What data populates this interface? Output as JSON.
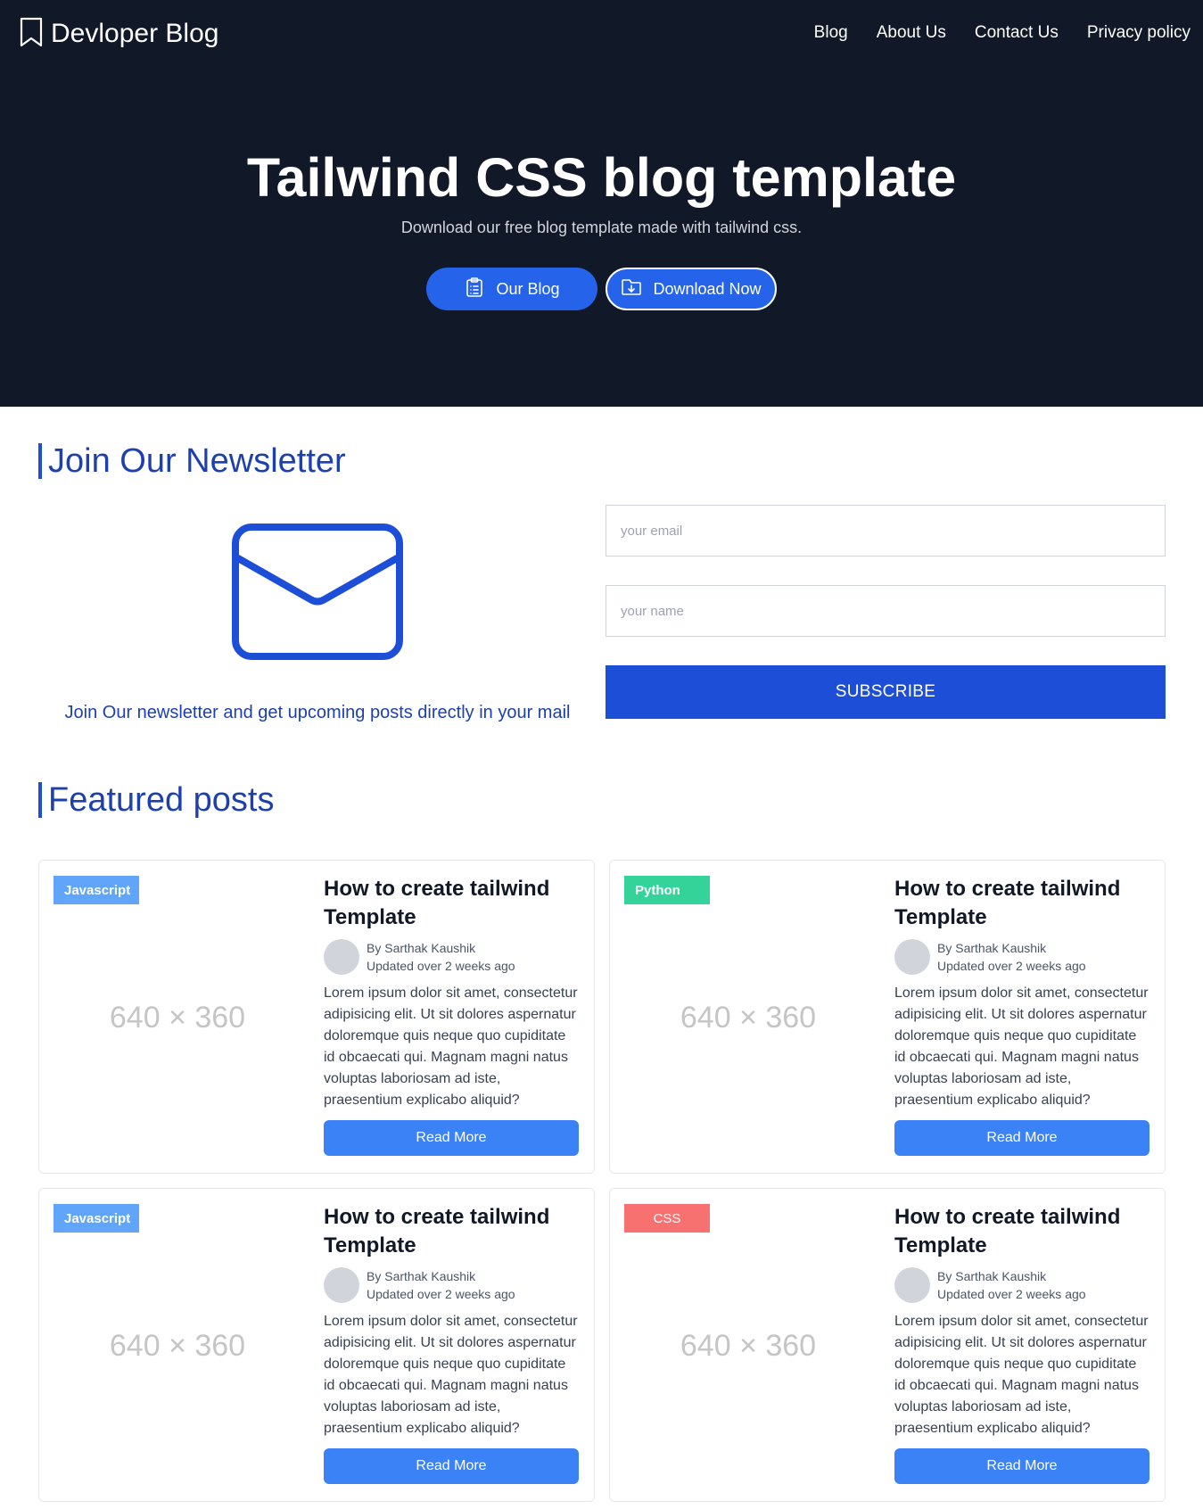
{
  "header": {
    "brand": "Devloper Blog",
    "brand_icon": "bookmark-icon",
    "nav": [
      "Blog",
      "About Us",
      "Contact Us",
      "Privacy policy"
    ]
  },
  "hero": {
    "title": "Tailwind CSS blog template",
    "subtitle": "Download our free blog template made with tailwind css.",
    "buttons": [
      {
        "label": "Our Blog",
        "icon": "clipboard-list-icon"
      },
      {
        "label": "Download Now",
        "icon": "download-folder-icon"
      }
    ]
  },
  "newsletter": {
    "heading": "Join Our Newsletter",
    "icon": "mail-icon",
    "text": "Join Our newsletter and get upcoming posts directly in your mail",
    "email_placeholder": "your email",
    "name_placeholder": "your name",
    "email_value": "",
    "name_value": "",
    "subscribe_label": "SUBSCRIBE"
  },
  "featured": {
    "heading": "Featured posts",
    "posts": [
      {
        "tag": "Javascript",
        "image_placeholder": "640 × 360",
        "title": "How to create tailwind Template",
        "author": "By Sarthak Kaushik",
        "updated": "Updated over 2 weeks ago",
        "excerpt": "Lorem ipsum dolor sit amet, consectetur adipisicing elit. Ut sit dolores aspernatur doloremque quis neque quo cupiditate id obcaecati qui. Magnam magni natus voluptas laboriosam ad iste, praesentium explicabo aliquid?",
        "button": "Read More"
      },
      {
        "tag": "Python",
        "image_placeholder": "640 × 360",
        "title": "How to create tailwind Template",
        "author": "By Sarthak Kaushik",
        "updated": "Updated over 2 weeks ago",
        "excerpt": "Lorem ipsum dolor sit amet, consectetur adipisicing elit. Ut sit dolores aspernatur doloremque quis neque quo cupiditate id obcaecati qui. Magnam magni natus voluptas laboriosam ad iste, praesentium explicabo aliquid?",
        "button": "Read More"
      },
      {
        "tag": "Javascript",
        "image_placeholder": "640 × 360",
        "title": "How to create tailwind Template",
        "author": "By Sarthak Kaushik",
        "updated": "Updated over 2 weeks ago",
        "excerpt": "Lorem ipsum dolor sit amet, consectetur adipisicing elit. Ut sit dolores aspernatur doloremque quis neque quo cupiditate id obcaecati qui. Magnam magni natus voluptas laboriosam ad iste, praesentium explicabo aliquid?",
        "button": "Read More"
      },
      {
        "tag": "CSS",
        "image_placeholder": "640 × 360",
        "title": "How to create tailwind Template",
        "author": "By Sarthak Kaushik",
        "updated": "Updated over 2 weeks ago",
        "excerpt": "Lorem ipsum dolor sit amet, consectetur adipisicing elit. Ut sit dolores aspernatur doloremque quis neque quo cupiditate id obcaecati qui. Magnam magni natus voluptas laboriosam ad iste, praesentium explicabo aliquid?",
        "button": "Read More"
      }
    ]
  },
  "colors": {
    "hero_bg": "#111827",
    "primary": "#2563eb",
    "heading_blue": "#1e40af",
    "tag_javascript": "#60a5fa",
    "tag_python": "#34d399",
    "tag_css": "#f87171"
  }
}
